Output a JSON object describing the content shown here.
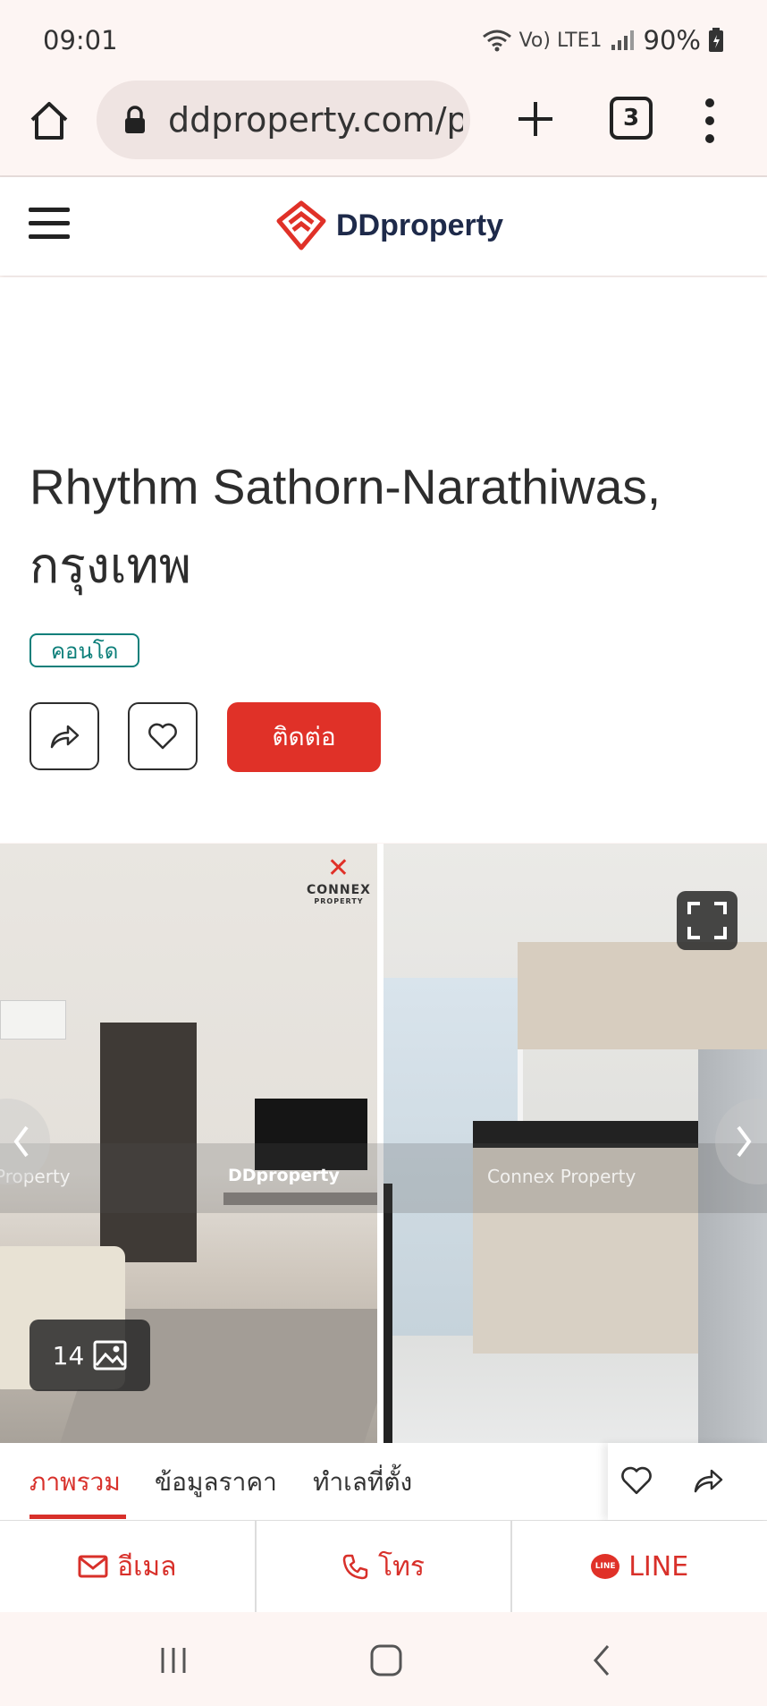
{
  "status_bar": {
    "time": "09:01",
    "battery": "90%",
    "network": "Vo) LTE1"
  },
  "browser": {
    "url": "ddproperty.com/pr",
    "tab_count": "3"
  },
  "site": {
    "logo_text": "DDproperty",
    "brand_color": "#e03128"
  },
  "listing": {
    "title": "Rhythm Sathorn-Narathiwas, กรุงเทพ",
    "badge": "คอนโด",
    "contact_label": "ติดต่อ"
  },
  "gallery": {
    "photo_count": "14",
    "watermarks": [
      "DDproperty",
      "Connex Property",
      "Property"
    ],
    "connex_logo": "CONNEX",
    "connex_sub": "PROPERTY"
  },
  "tabs": [
    {
      "label": "ภาพรวม",
      "active": true
    },
    {
      "label": "ข้อมูลราคา",
      "active": false
    },
    {
      "label": "ทำเลที่ตั้ง",
      "active": false
    }
  ],
  "actions": {
    "email_label": "อีเมล",
    "call_label": "โทร",
    "line_label": "LINE",
    "line_badge": "LINE"
  },
  "colors": {
    "accent": "#d8302a",
    "badge": "#0d7f7a"
  }
}
